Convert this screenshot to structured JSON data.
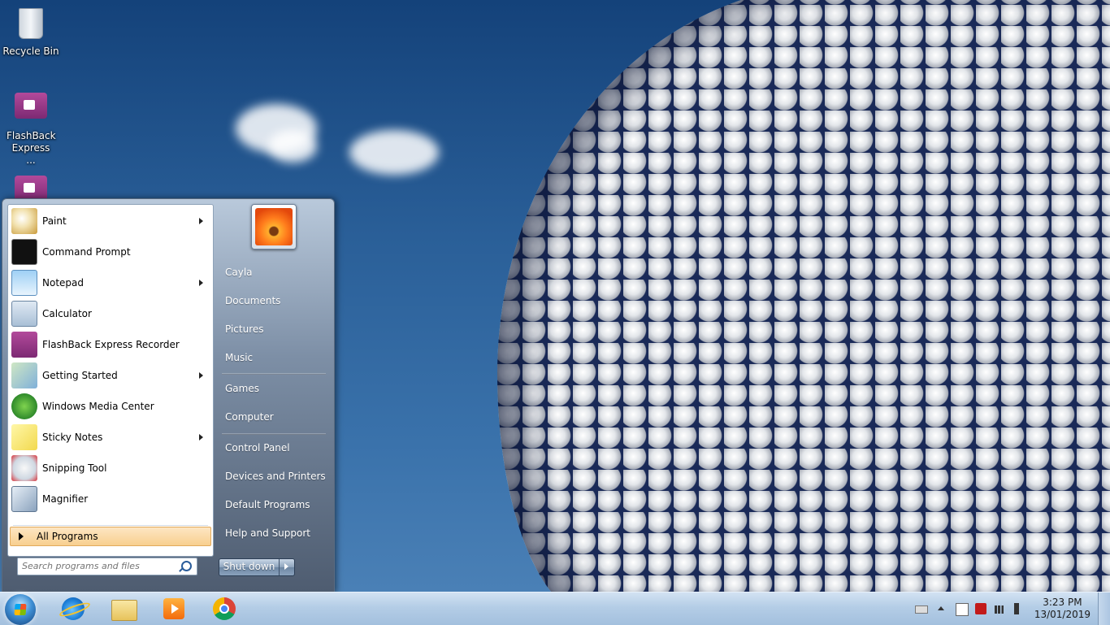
{
  "desktop": {
    "icons": [
      {
        "label": "Recycle Bin"
      },
      {
        "label": "FlashBack Express ..."
      },
      {
        "label": ""
      }
    ]
  },
  "start_menu": {
    "programs": [
      {
        "label": "Paint",
        "has_submenu": true,
        "icon": "paint-icon"
      },
      {
        "label": "Command Prompt",
        "has_submenu": false,
        "icon": "cmd-icon"
      },
      {
        "label": "Notepad",
        "has_submenu": true,
        "icon": "notepad-icon"
      },
      {
        "label": "Calculator",
        "has_submenu": false,
        "icon": "calculator-icon"
      },
      {
        "label": "FlashBack Express Recorder",
        "has_submenu": false,
        "icon": "flashback-icon"
      },
      {
        "label": "Getting Started",
        "has_submenu": true,
        "icon": "getting-started-icon"
      },
      {
        "label": "Windows Media Center",
        "has_submenu": false,
        "icon": "media-center-icon"
      },
      {
        "label": "Sticky Notes",
        "has_submenu": true,
        "icon": "sticky-notes-icon"
      },
      {
        "label": "Snipping Tool",
        "has_submenu": false,
        "icon": "snipping-tool-icon"
      },
      {
        "label": "Magnifier",
        "has_submenu": false,
        "icon": "magnifier-icon"
      }
    ],
    "all_programs": "All Programs",
    "search_placeholder": "Search programs and files",
    "user_name": "Cayla",
    "links": [
      "Documents",
      "Pictures",
      "Music",
      "Games",
      "Computer",
      "Control Panel",
      "Devices and Printers",
      "Default Programs",
      "Help and Support"
    ],
    "shutdown_label": "Shut down"
  },
  "taskbar": {
    "apps": [
      "internet-explorer-icon",
      "windows-explorer-icon",
      "media-player-icon",
      "chrome-icon"
    ],
    "time": "3:23 PM",
    "date": "13/01/2019"
  }
}
